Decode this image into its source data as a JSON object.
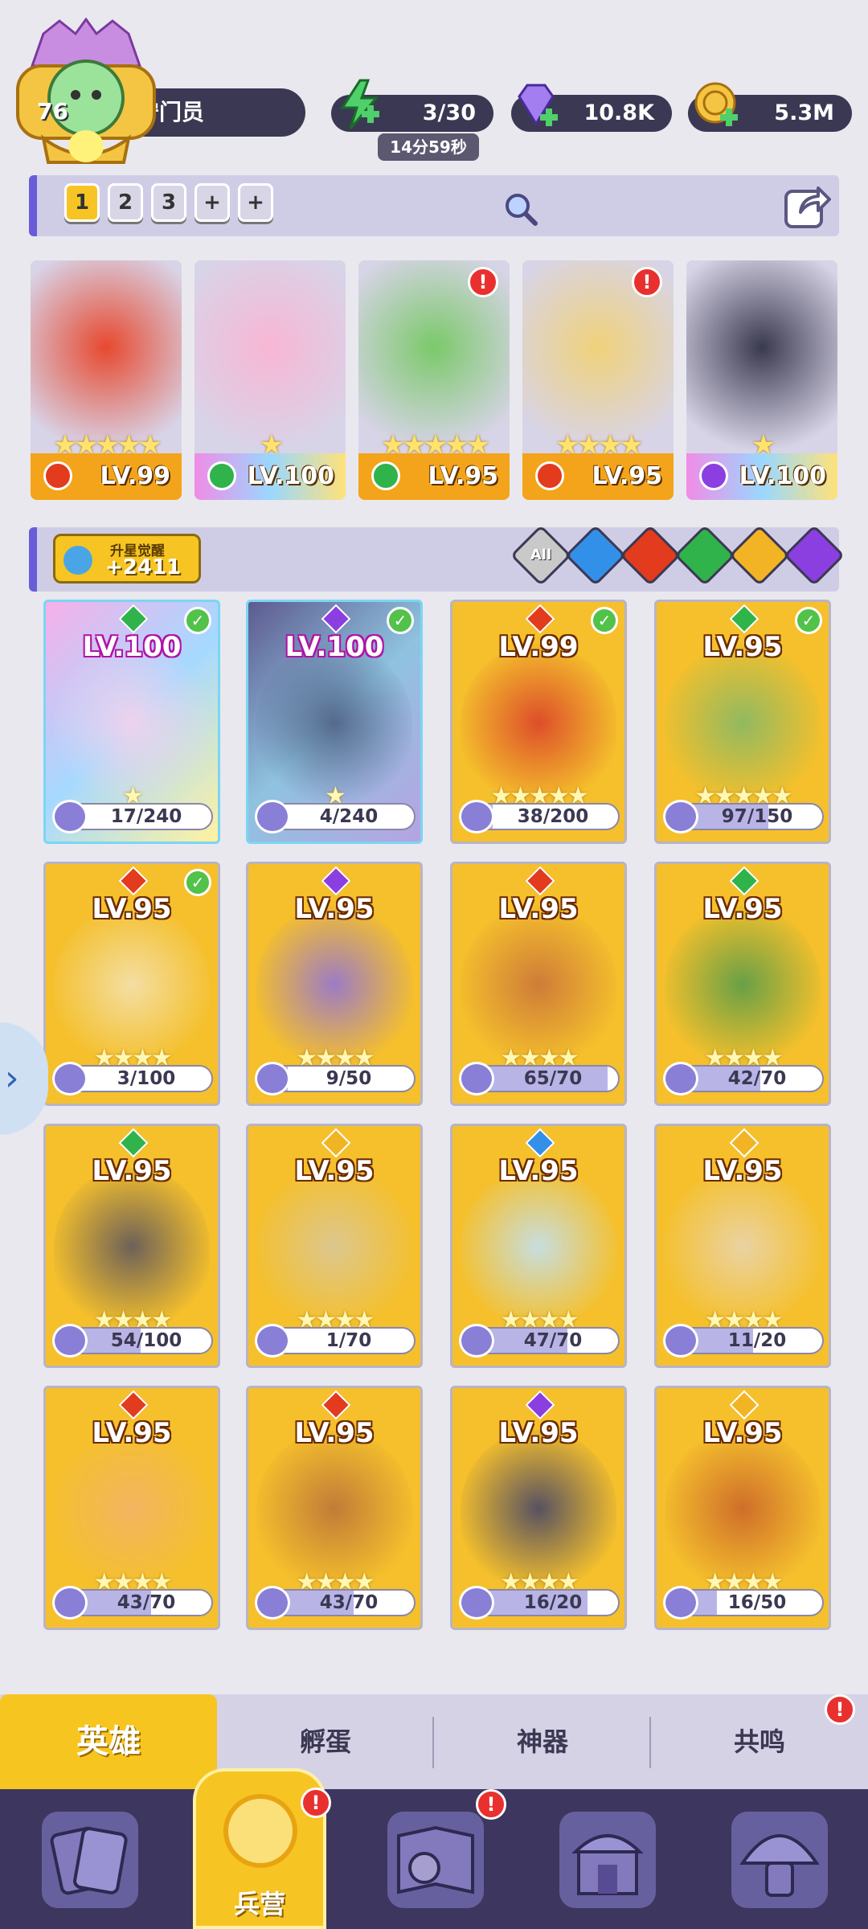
{
  "player": {
    "level": "76",
    "name": "守门员"
  },
  "resources": {
    "energy": "3/30",
    "energy_timer": "14分59秒",
    "gems": "10.8K",
    "coins": "5.3M"
  },
  "teams": {
    "tabs": [
      "1",
      "2",
      "3",
      "+",
      "+"
    ],
    "selected": "1"
  },
  "team_cards": [
    {
      "level": "LV.99",
      "element": "fire",
      "stars": "★★★★★",
      "alert": false,
      "rainbow": false
    },
    {
      "level": "LV.100",
      "element": "wind",
      "stars": "★",
      "alert": false,
      "rainbow": true
    },
    {
      "level": "LV.95",
      "element": "wind",
      "stars": "★★★★★",
      "alert": true,
      "rainbow": false
    },
    {
      "level": "LV.95",
      "element": "fire",
      "stars": "★★★★",
      "alert": true,
      "rainbow": false
    },
    {
      "level": "LV.100",
      "element": "dark",
      "stars": "★",
      "alert": false,
      "rainbow": true
    }
  ],
  "awaken": {
    "title": "升星觉醒",
    "value": "+2411"
  },
  "filters": {
    "all_label": "All",
    "elements": [
      "water",
      "fire",
      "wind",
      "light",
      "dark"
    ],
    "colors": {
      "water": "#3290e8",
      "fire": "#e23b1d",
      "wind": "#2fb34a",
      "light": "#f2b424",
      "dark": "#8b3fe0"
    }
  },
  "heroes": [
    {
      "level": "LV.100",
      "element": "wind",
      "progress": "17/240",
      "fraction": 0.07,
      "checked": true,
      "rainbow": true,
      "stars": "★"
    },
    {
      "level": "LV.100",
      "element": "dark",
      "progress": "4/240",
      "fraction": 0.02,
      "checked": true,
      "rainbow": true,
      "stars": "★"
    },
    {
      "level": "LV.99",
      "element": "fire",
      "progress": "38/200",
      "fraction": 0.19,
      "checked": true,
      "rainbow": false,
      "stars": "★★★★★"
    },
    {
      "level": "LV.95",
      "element": "wind",
      "progress": "97/150",
      "fraction": 0.65,
      "checked": true,
      "rainbow": false,
      "stars": "★★★★★"
    },
    {
      "level": "LV.95",
      "element": "fire",
      "progress": "3/100",
      "fraction": 0.03,
      "checked": true,
      "rainbow": false,
      "stars": "★★★★"
    },
    {
      "level": "LV.95",
      "element": "dark",
      "progress": "9/50",
      "fraction": 0.18,
      "checked": false,
      "rainbow": false,
      "stars": "★★★★"
    },
    {
      "level": "LV.95",
      "element": "fire",
      "progress": "65/70",
      "fraction": 0.93,
      "checked": false,
      "rainbow": false,
      "stars": "★★★★"
    },
    {
      "level": "LV.95",
      "element": "wind",
      "progress": "42/70",
      "fraction": 0.6,
      "checked": false,
      "rainbow": false,
      "stars": "★★★★"
    },
    {
      "level": "LV.95",
      "element": "wind",
      "progress": "54/100",
      "fraction": 0.54,
      "checked": false,
      "rainbow": false,
      "stars": "★★★★"
    },
    {
      "level": "LV.95",
      "element": "light",
      "progress": "1/70",
      "fraction": 0.01,
      "checked": false,
      "rainbow": false,
      "stars": "★★★★"
    },
    {
      "level": "LV.95",
      "element": "water",
      "progress": "47/70",
      "fraction": 0.67,
      "checked": false,
      "rainbow": false,
      "stars": "★★★★"
    },
    {
      "level": "LV.95",
      "element": "light",
      "progress": "11/20",
      "fraction": 0.55,
      "checked": false,
      "rainbow": false,
      "stars": "★★★★"
    },
    {
      "level": "LV.95",
      "element": "fire",
      "progress": "43/70",
      "fraction": 0.61,
      "checked": false,
      "rainbow": false,
      "stars": "★★★★"
    },
    {
      "level": "LV.95",
      "element": "fire",
      "progress": "43/70",
      "fraction": 0.61,
      "checked": false,
      "rainbow": false,
      "stars": "★★★★"
    },
    {
      "level": "LV.95",
      "element": "dark",
      "progress": "16/20",
      "fraction": 0.8,
      "checked": false,
      "rainbow": false,
      "stars": "★★★★"
    },
    {
      "level": "LV.95",
      "element": "light",
      "progress": "16/50",
      "fraction": 0.32,
      "checked": false,
      "rainbow": false,
      "stars": "★★★★"
    }
  ],
  "subtabs": {
    "heroes": "英雄",
    "hatch": "孵蛋",
    "artifact": "神器",
    "resonance": "共鸣"
  },
  "nav": {
    "barracks": "兵营"
  },
  "badges": {
    "alert": "!"
  }
}
